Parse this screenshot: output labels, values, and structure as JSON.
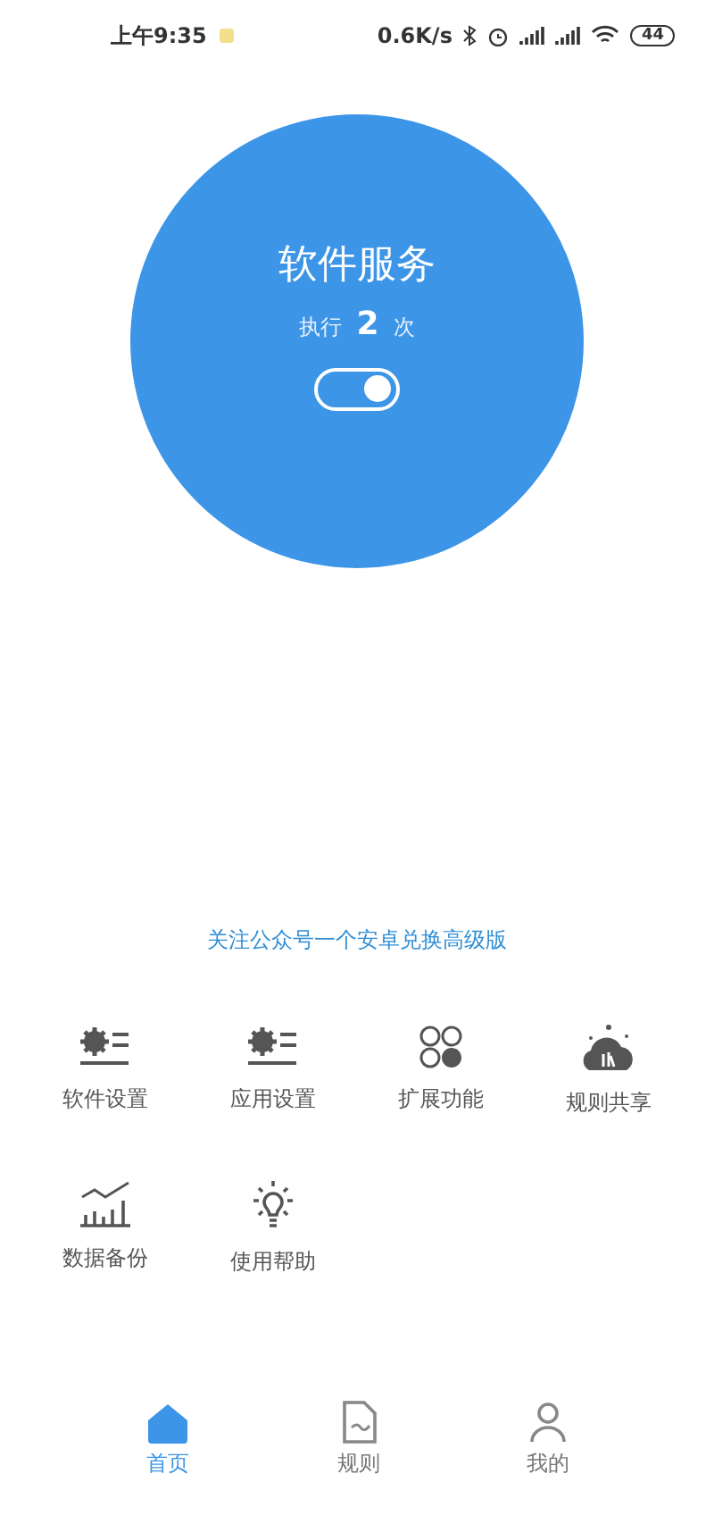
{
  "status_bar": {
    "time": "上午9:35",
    "speed": "0.6K/s",
    "battery": "44"
  },
  "service": {
    "title": "软件服务",
    "count_prefix": "执行",
    "count": "2",
    "count_suffix": "次",
    "on": true
  },
  "promo_link": "关注公众号一个安卓兑换高级版",
  "features": [
    {
      "kind": "gear",
      "label": "软件设置"
    },
    {
      "kind": "gear",
      "label": "应用设置"
    },
    {
      "kind": "circles",
      "label": "扩展功能"
    },
    {
      "kind": "cloud",
      "label": "规则共享"
    },
    {
      "kind": "chart",
      "label": "数据备份"
    },
    {
      "kind": "bulb",
      "label": "使用帮助"
    }
  ],
  "tabs": [
    {
      "kind": "home",
      "label": "首页",
      "selected": true
    },
    {
      "kind": "doc",
      "label": "规则",
      "selected": false
    },
    {
      "kind": "user",
      "label": "我的",
      "selected": false
    }
  ]
}
